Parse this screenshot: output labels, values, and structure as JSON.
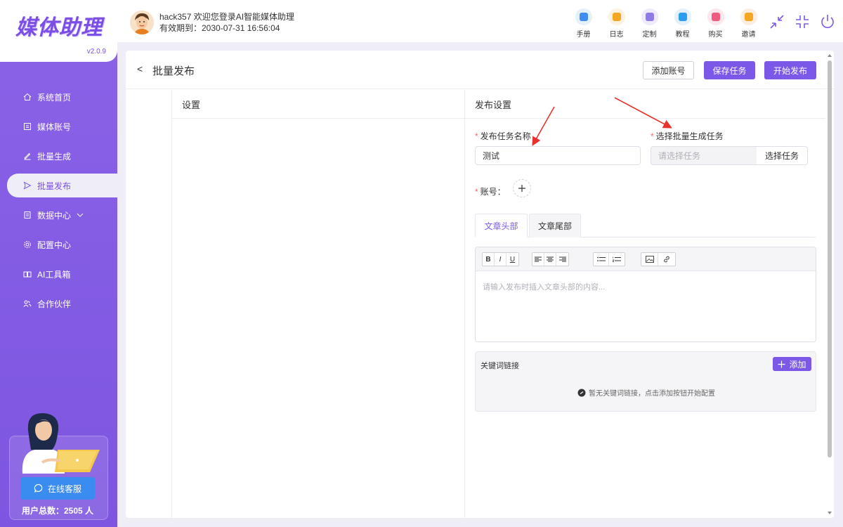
{
  "app": {
    "logo": "媒体助理",
    "version": "v2.0.9"
  },
  "sidebar": {
    "items": [
      {
        "label": "系统首页",
        "icon": "home-icon"
      },
      {
        "label": "媒体账号",
        "icon": "account-icon"
      },
      {
        "label": "批量生成",
        "icon": "pen-icon"
      },
      {
        "label": "批量发布",
        "icon": "send-icon",
        "active": true
      },
      {
        "label": "数据中心",
        "icon": "data-icon"
      },
      {
        "label": "配置中心",
        "icon": "gear-icon"
      },
      {
        "label": "AI工具箱",
        "icon": "toolbox-icon"
      },
      {
        "label": "合作伙伴",
        "icon": "partner-icon"
      }
    ],
    "service_button": "在线客服",
    "user_count": "用户总数：2505 人"
  },
  "header": {
    "welcome_line1": "hack357 欢迎您登录AI智能媒体助理",
    "welcome_line2": "有效期到：2030-07-31 16:56:04",
    "tools": [
      {
        "label": "手册",
        "icon": "manual-icon",
        "color": "#3d8ef0",
        "bg": "#e5f0fd"
      },
      {
        "label": "日志",
        "icon": "log-icon",
        "color": "#f5a623",
        "bg": "#fdf2e0"
      },
      {
        "label": "定制",
        "icon": "custom-icon",
        "color": "#8f7ae8",
        "bg": "#efeafc"
      },
      {
        "label": "教程",
        "icon": "tutorial-icon",
        "color": "#2d9cf0",
        "bg": "#e2f1fd"
      },
      {
        "label": "购买",
        "icon": "purchase-icon",
        "color": "#f05a7e",
        "bg": "#fde6ec"
      },
      {
        "label": "邀请",
        "icon": "invite-icon",
        "color": "#f5a623",
        "bg": "#fdeee0"
      }
    ]
  },
  "page": {
    "back": "<",
    "title": "批量发布",
    "add_account": "添加账号",
    "save_task": "保存任务",
    "start_publish": "开始发布"
  },
  "settings": {
    "header": "设置"
  },
  "publish": {
    "header": "发布设置",
    "task_name_label": "发布任务名称",
    "task_name_value": "测试",
    "select_task_label": "选择批量生成任务",
    "select_task_placeholder": "请选择任务",
    "select_task_button": "选择任务",
    "account_label": "账号：",
    "tabs": [
      "文章头部",
      "文章尾部"
    ],
    "editor_placeholder": "请输入发布时插入文章头部的内容...",
    "keywords_title": "关键词链接",
    "keywords_add": "添加",
    "keywords_empty": "暂无关键词链接，点击添加按钮开始配置"
  },
  "colors": {
    "accent": "#7b58e8",
    "sidebar": "#8a63e8",
    "required": "#f56c6c",
    "service": "#3b8cf0",
    "annotation_arrow": "#e8322d"
  }
}
